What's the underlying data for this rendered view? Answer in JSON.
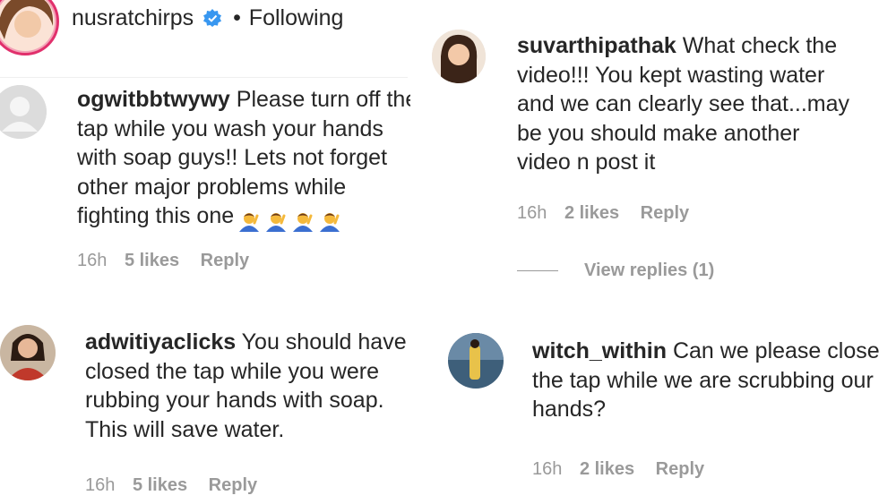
{
  "header": {
    "username": "nusratchirps",
    "separator": "•",
    "follow_label": "Following"
  },
  "comments": [
    {
      "username": "ogwitbbtwywy",
      "lines": [
        "Please turn off the",
        "tap while you wash your hands",
        "with soap guys!! Lets not forget",
        "other major problems while",
        "fighting this one"
      ],
      "time": "16h",
      "likes": "5 likes",
      "reply": "Reply",
      "emoji_count": 4
    },
    {
      "username": "adwitiyaclicks",
      "lines": [
        "You should have",
        "closed the tap while you were",
        "rubbing your hands with soap.",
        "This will save water."
      ],
      "time": "16h",
      "likes": "5 likes",
      "reply": "Reply"
    },
    {
      "username": "suvarthipathak",
      "lines": [
        "What check the",
        "video!!! You kept wasting water",
        "and we can clearly see that...may",
        "be you should make another",
        "video n post it"
      ],
      "time": "16h",
      "likes": "2 likes",
      "reply": "Reply",
      "view_replies": "View replies (1)"
    },
    {
      "username": "witch_within",
      "lines": [
        "Can we please close",
        "the tap while we are scrubbing our",
        "hands?"
      ],
      "time": "16h",
      "likes": "2 likes",
      "reply": "Reply"
    }
  ],
  "colors": {
    "verified": "#3897f0",
    "meta_text": "#9a9a9a",
    "story_ring": "#e1306c"
  },
  "icons": [
    "verified-badge-icon",
    "man-raising-hand-emoji"
  ]
}
